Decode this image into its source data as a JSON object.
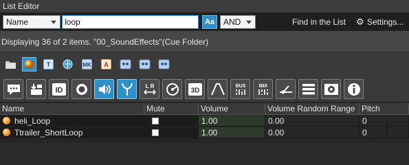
{
  "window": {
    "title": "List Editor"
  },
  "filter": {
    "field_select": "Name",
    "search_value": "loop",
    "case_button": "Aa",
    "logic_select": "AND",
    "find_link": "Find in the List",
    "settings_label": "Settings..."
  },
  "status": {
    "text": "Displaying 36 of 2 items. \"00_SoundEffects\"(Cue Folder)"
  },
  "type_filters": [
    {
      "icon": "folder-icon"
    },
    {
      "icon": "cue-orb-icon",
      "selected": true
    },
    {
      "icon": "track-t-icon"
    },
    {
      "icon": "waveform-globe-icon"
    },
    {
      "icon": "mk-icon",
      "label": "MK"
    },
    {
      "icon": "aisac-a-icon"
    },
    {
      "icon": "sound-link-icon-1"
    },
    {
      "icon": "sound-link-icon-2"
    },
    {
      "icon": "sound-link-icon-3"
    }
  ],
  "column_tools": [
    "comment-icon",
    "category-icon",
    "id-icon",
    "record-icon",
    "volume-icon",
    "pitch-icon",
    "lr-pan-icon",
    "pan3d-circle-icon",
    "pan3d-icon",
    "envelope-icon",
    "bus-icon",
    "mix-icon",
    "send-icon",
    "list-icon",
    "media-icon",
    "info-icon"
  ],
  "column_tool_labels": {
    "id": "ID",
    "pan3d": "3D",
    "bus": "BUS",
    "mix": "MIX",
    "lr": "L R"
  },
  "table": {
    "columns": [
      "Name",
      "Mute",
      "Volume",
      "Volume Random Range",
      "Pitch"
    ],
    "rows": [
      {
        "name": "heli_Loop",
        "mute": false,
        "volume": "1.00",
        "volume_random_range": "0.00",
        "pitch": "0"
      },
      {
        "name": "Ttrailer_ShortLoop",
        "mute": false,
        "volume": "1.00",
        "volume_random_range": "0.00",
        "pitch": "0"
      }
    ]
  },
  "colors": {
    "accent": "#2f8fc8",
    "volume_cell": "#2e3b2c",
    "orb": "#f29a20"
  }
}
